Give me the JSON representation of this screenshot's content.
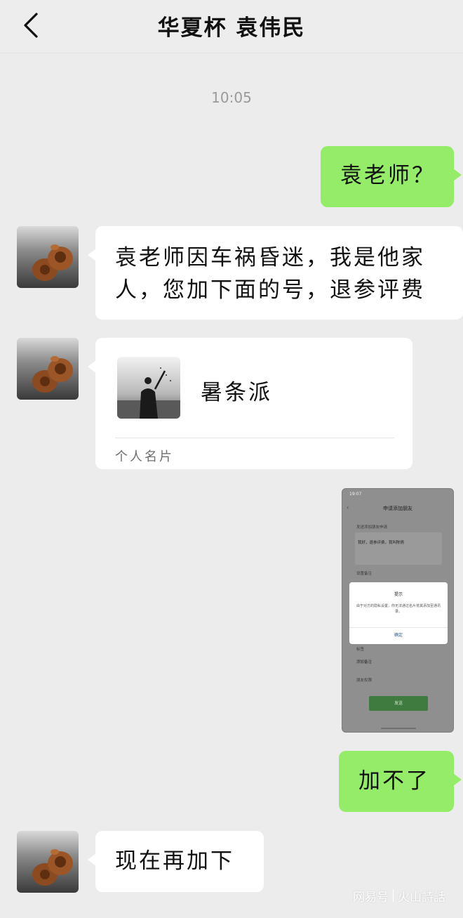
{
  "header": {
    "title": "华夏杯 袁伟民",
    "back_icon": "chevron-left-icon"
  },
  "timestamp": "10:05",
  "messages": {
    "m1": {
      "text": "袁老师？"
    },
    "m2": {
      "line1": "袁老师因车祸昏迷，我是他家",
      "line2": "人，您加下面的号，退参评费"
    },
    "m3": {
      "name": "暑条派",
      "label": "个人名片"
    },
    "m4": {
      "status": "19:07",
      "title": "申请添加朋友",
      "section1": "发送添加朋友申请",
      "greeting": "我好，退参评费，我叫陈倩",
      "remark_label": "设置备注",
      "dialog_title": "提示",
      "dialog_msg": "由于对方的隐私设置，你无法通过名片将其添加至通讯录。",
      "dialog_ok": "确定",
      "tag_label": "标签",
      "tag_value": "添加备注",
      "perm_label": "朋友权限",
      "send": "发送"
    },
    "m5": {
      "text": "加不了"
    },
    "m6": {
      "text": "现在再加下"
    }
  },
  "watermark": {
    "left": "网易号",
    "right": "火山詩話"
  },
  "colors": {
    "sent_bubble": "#95ec69",
    "received_bubble": "#ffffff",
    "background": "#ececec"
  }
}
